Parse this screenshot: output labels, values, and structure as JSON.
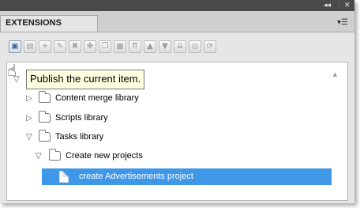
{
  "window": {
    "collapse_icon": "double-left-arrow-icon",
    "close_icon": "close-icon",
    "collapse_glyph": "◂◂",
    "close_glyph": "✕"
  },
  "panel": {
    "tab_title": "EXTENSIONS",
    "menu_icon": "panel-menu-icon"
  },
  "toolbar": {
    "buttons": [
      {
        "icon": "publish-icon",
        "glyph": "▣",
        "active": true
      },
      {
        "icon": "save-icon",
        "glyph": "▤"
      },
      {
        "icon": "add-icon",
        "glyph": "+"
      },
      {
        "icon": "edit-icon",
        "glyph": "✎"
      },
      {
        "icon": "delete-icon",
        "glyph": "✖"
      },
      {
        "icon": "move-icon",
        "glyph": "✥"
      },
      {
        "icon": "copy-icon",
        "glyph": "❐"
      },
      {
        "icon": "paste-icon",
        "glyph": "▦"
      },
      {
        "icon": "move-top-icon",
        "glyph": "⇈"
      },
      {
        "icon": "move-up-icon",
        "glyph": "▲"
      },
      {
        "icon": "move-down-icon",
        "glyph": "▼"
      },
      {
        "icon": "move-bottom-icon",
        "glyph": "⇊"
      },
      {
        "icon": "properties-icon",
        "glyph": "◎"
      },
      {
        "icon": "refresh-icon",
        "glyph": "⟳"
      }
    ]
  },
  "tooltip": {
    "text": "Publish the current item."
  },
  "tree": {
    "items": [
      {
        "label": "Content merge library",
        "expanded": false
      },
      {
        "label": "Scripts library",
        "expanded": false
      },
      {
        "label": "Tasks library",
        "expanded": true
      },
      {
        "label": "Create new projects",
        "expanded": true
      },
      {
        "label": "create Advertisements project",
        "selected": true
      }
    ]
  },
  "colors": {
    "selection": "#3f97e8",
    "tooltip_bg": "#ffffe1",
    "titlebar": "#4a4a4a"
  }
}
